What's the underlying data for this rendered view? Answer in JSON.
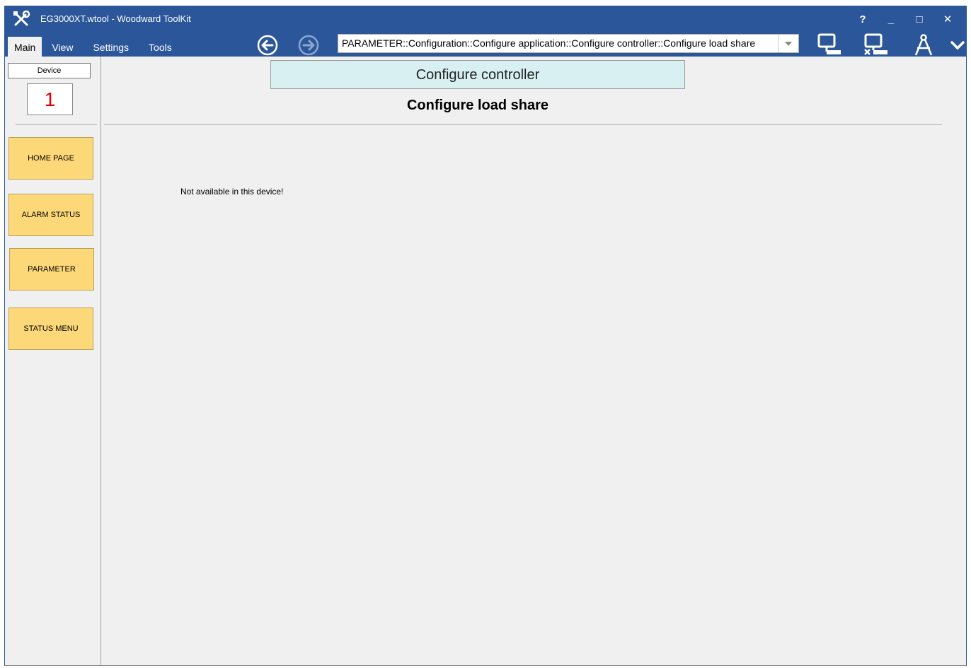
{
  "window": {
    "title": "EG3000XT.wtool - Woodward ToolKit",
    "controls": {
      "help": "?",
      "minimize": "_",
      "maximize": "□",
      "close": "✕"
    }
  },
  "menu": {
    "items": [
      "Main",
      "View",
      "Settings",
      "Tools"
    ],
    "active": "Main"
  },
  "toolbar": {
    "back_icon": "arrow-left-circle-icon",
    "forward_icon": "arrow-right-circle-icon",
    "path": "PARAMETER::Configuration::Configure application::Configure controller::Configure load share",
    "icons": [
      "connect-icon",
      "disconnect-icon",
      "compass-icon",
      "chevron-down-icon"
    ]
  },
  "sidebar": {
    "device_label": "Device",
    "device_number": "1",
    "buttons": [
      "HOME PAGE",
      "ALARM STATUS",
      "PARAMETER",
      "STATUS MENU"
    ]
  },
  "main": {
    "section_header": "Configure controller",
    "page_title": "Configure load share",
    "message": "Not available in this device!"
  },
  "colors": {
    "titlebar": "#2b579a",
    "tile": "#fdd878",
    "header_box": "#d9f0f3",
    "device_number": "#e00000"
  }
}
